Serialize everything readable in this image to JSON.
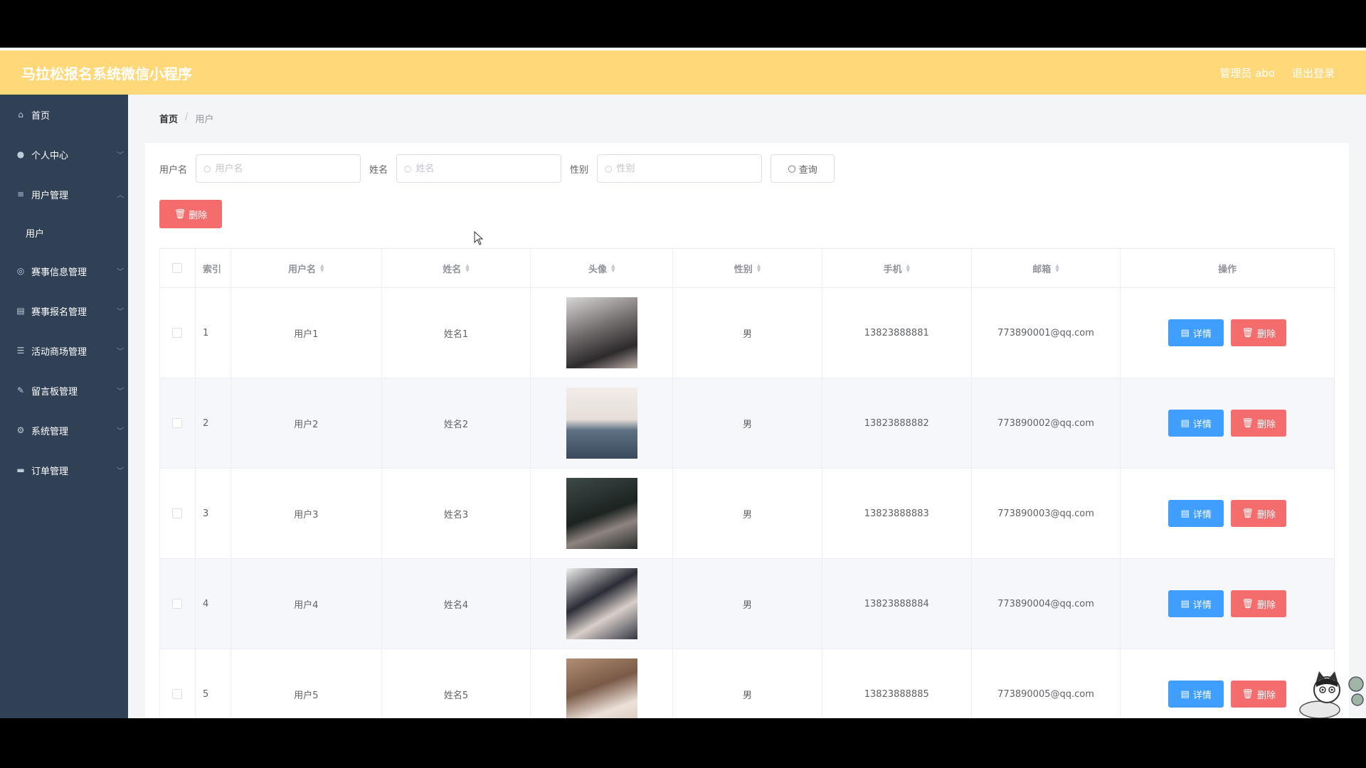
{
  "header": {
    "title": "马拉松报名系统微信小程序",
    "admin_label": "管理员 abo",
    "logout_label": "退出登录"
  },
  "sidebar": {
    "items": [
      {
        "label": "首页",
        "icon": "home-icon"
      },
      {
        "label": "个人中心",
        "icon": "user-icon"
      },
      {
        "label": "用户管理",
        "icon": "list-icon"
      },
      {
        "label": "赛事信息管理",
        "icon": "globe-icon"
      },
      {
        "label": "赛事报名管理",
        "icon": "clipboard-icon"
      },
      {
        "label": "活动商场管理",
        "icon": "sliders-icon"
      },
      {
        "label": "留言板管理",
        "icon": "edit-icon"
      },
      {
        "label": "系统管理",
        "icon": "settings-icon"
      },
      {
        "label": "订单管理",
        "icon": "monitor-icon"
      }
    ],
    "sub_item": "用户"
  },
  "breadcrumb": {
    "home": "首页",
    "separator": "/",
    "current": "用户"
  },
  "search": {
    "username_label": "用户名",
    "username_placeholder": "用户名",
    "name_label": "姓名",
    "name_placeholder": "姓名",
    "gender_label": "性别",
    "gender_placeholder": "性别",
    "query_label": "查询"
  },
  "actions": {
    "bulk_delete_label": "删除"
  },
  "table": {
    "headers": {
      "index": "索引",
      "username": "用户名",
      "name": "姓名",
      "avatar": "头像",
      "gender": "性别",
      "phone": "手机",
      "email": "邮箱",
      "ops": "操作"
    },
    "detail_label": "详情",
    "delete_label": "删除",
    "rows": [
      {
        "index": "1",
        "username": "用户1",
        "name": "姓名1",
        "gender": "男",
        "phone": "13823888881",
        "email": "773890001@qq.com"
      },
      {
        "index": "2",
        "username": "用户2",
        "name": "姓名2",
        "gender": "男",
        "phone": "13823888882",
        "email": "773890002@qq.com"
      },
      {
        "index": "3",
        "username": "用户3",
        "name": "姓名3",
        "gender": "男",
        "phone": "13823888883",
        "email": "773890003@qq.com"
      },
      {
        "index": "4",
        "username": "用户4",
        "name": "姓名4",
        "gender": "男",
        "phone": "13823888884",
        "email": "773890004@qq.com"
      },
      {
        "index": "5",
        "username": "用户5",
        "name": "姓名5",
        "gender": "男",
        "phone": "13823888885",
        "email": "773890005@qq.com"
      }
    ]
  },
  "colors": {
    "header_bg": "#ffd879",
    "sidebar_bg": "#304156",
    "primary": "#409eff",
    "danger": "#f56c6c"
  }
}
